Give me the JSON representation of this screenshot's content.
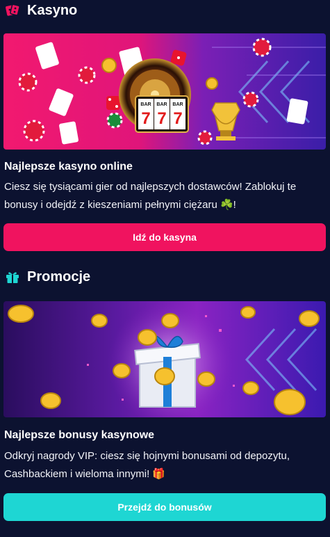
{
  "casino": {
    "section_title": "Kasyno",
    "icon": "dice-icon",
    "card_title": "Najlepsze kasyno online",
    "card_text": "Ciesz się tysiącami gier od najlepszych dostawców! Zablokuj te bonusy i odejdź z kieszeniami pełnymi ciężaru",
    "card_text_emoji": "☘️",
    "card_text_end": "!",
    "button_label": "Idź do kasyna",
    "slot_symbols": [
      "7",
      "7",
      "7"
    ],
    "slot_bar_labels": [
      "BAR",
      "BAR",
      "BAR"
    ]
  },
  "promotions": {
    "section_title": "Promocje",
    "icon": "gift-icon",
    "card_title": "Najlepsze bonusy kasynowe",
    "card_text": "Odkryj nagrody VIP: ciesz się hojnymi bonusami od depozytu, Cashbackiem i wieloma innymi!",
    "card_text_emoji": "🎁",
    "button_label": "Przejdź do bonusów"
  },
  "colors": {
    "background": "#0c1230",
    "accent_pink": "#f0135f",
    "accent_cyan": "#1ed6d3"
  }
}
